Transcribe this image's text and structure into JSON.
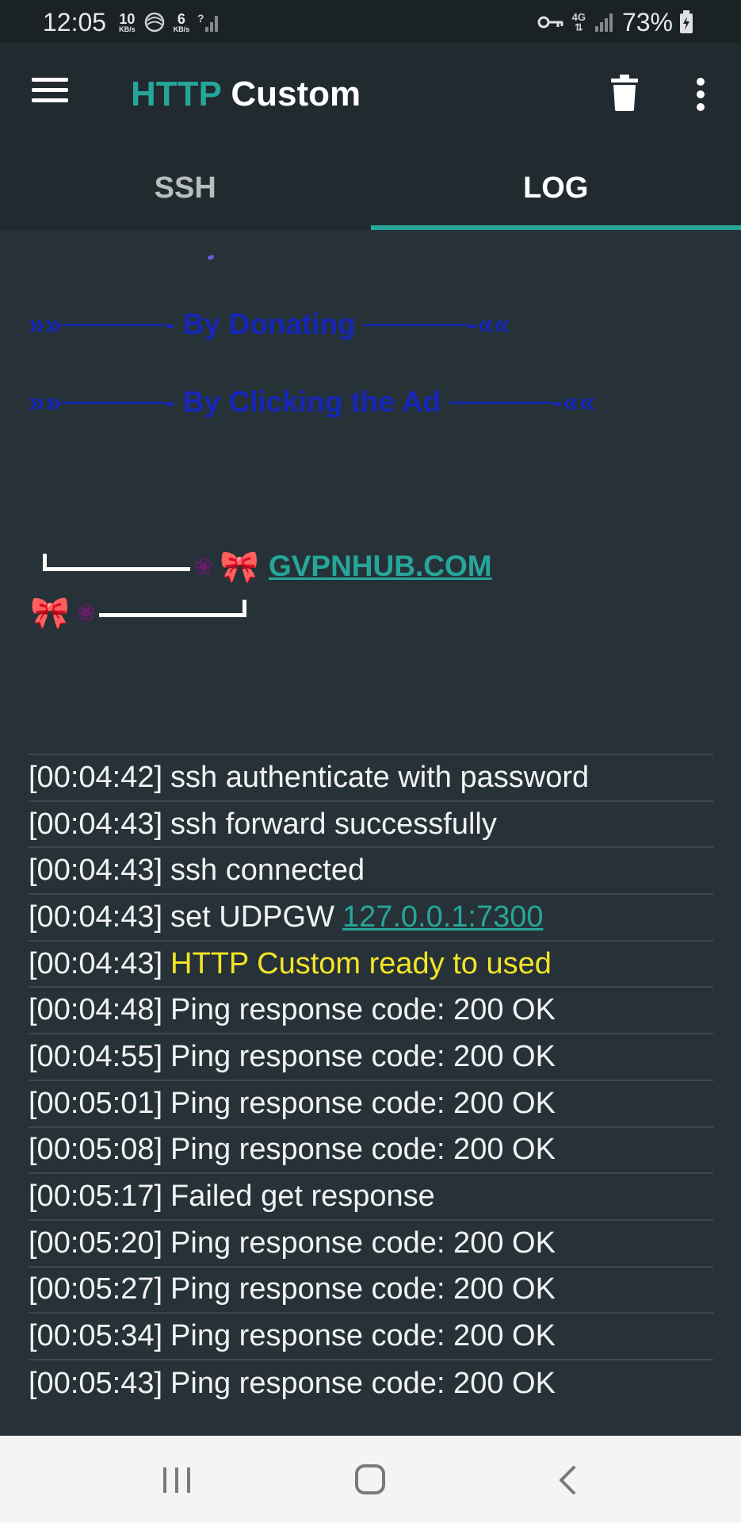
{
  "status_bar": {
    "time": "12:05",
    "speed_down": {
      "value": "10",
      "unit": "KB/s"
    },
    "speed_up": {
      "value": "6",
      "unit": "KB/s"
    },
    "network_type": "4G",
    "battery": "73%"
  },
  "toolbar": {
    "title_part1": "HTTP",
    "title_part2": "Custom",
    "accent_color": "#26a69a"
  },
  "tabs": [
    {
      "label": "SSH",
      "active": false
    },
    {
      "label": "LOG",
      "active": true
    }
  ],
  "banner": {
    "line1": "»»─────- By Donating ─────-««",
    "line2": "»»─────- By Clicking the Ad ─────-««",
    "flower": "❀",
    "bow": "🎀",
    "link": "GVPNHUB.COM",
    "banner_color": "#1727b8"
  },
  "log": [
    {
      "ts": "[00:04:42]",
      "text": "ssh authenticate with password"
    },
    {
      "ts": "[00:04:43]",
      "text": "ssh forward successfully"
    },
    {
      "ts": "[00:04:43]",
      "text": "ssh connected"
    },
    {
      "ts": "[00:04:43]",
      "text": "set UDPGW",
      "link": "127.0.0.1:7300"
    },
    {
      "ts": "[00:04:43]",
      "highlight": "HTTP Custom ready to used"
    },
    {
      "ts": "[00:04:48]",
      "text": "Ping response code: 200 OK"
    },
    {
      "ts": "[00:04:55]",
      "text": "Ping response code: 200 OK"
    },
    {
      "ts": "[00:05:01]",
      "text": "Ping response code: 200 OK"
    },
    {
      "ts": "[00:05:08]",
      "text": "Ping response code: 200 OK"
    },
    {
      "ts": "[00:05:17]",
      "text": "Failed get response"
    },
    {
      "ts": "[00:05:20]",
      "text": "Ping response code: 200 OK"
    },
    {
      "ts": "[00:05:27]",
      "text": "Ping response code: 200 OK"
    },
    {
      "ts": "[00:05:34]",
      "text": "Ping response code: 200 OK"
    },
    {
      "ts": "[00:05:43]",
      "text": "Ping response code: 200 OK"
    }
  ]
}
